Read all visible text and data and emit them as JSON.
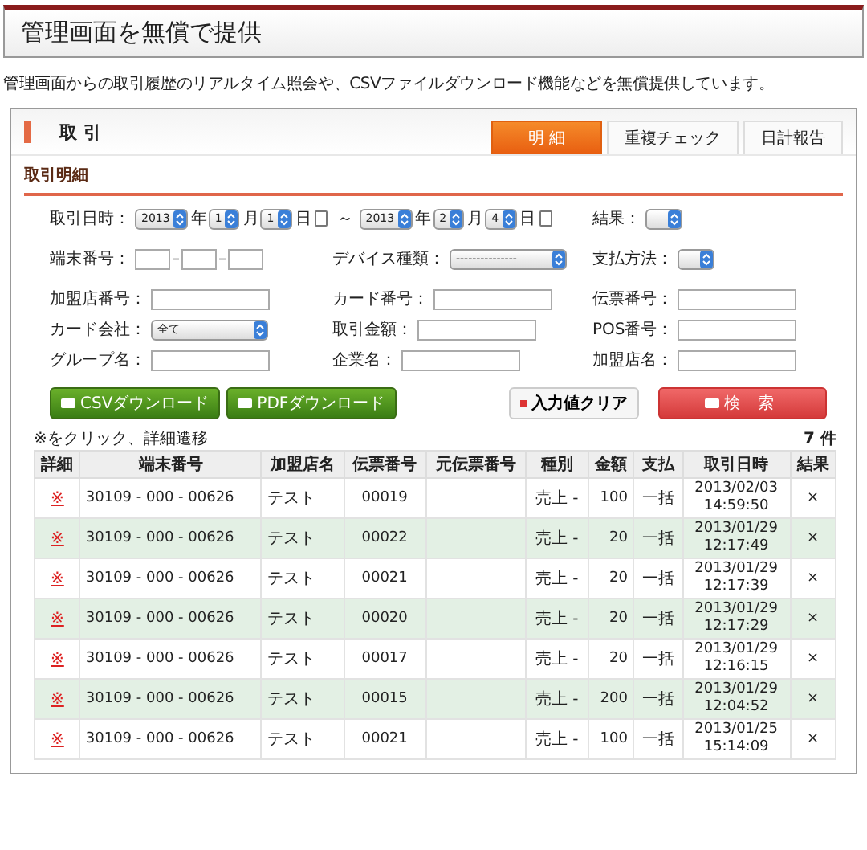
{
  "heading": "管理画面を無償で提供",
  "lead": "管理画面からの取引履歴のリアルタイム照会や、CSVファイルダウンロード機能などを無償提供しています。",
  "panel": {
    "title": "取 引",
    "tabs": [
      {
        "label": "明 細",
        "selected": true
      },
      {
        "label": "重複チェック",
        "selected": false
      },
      {
        "label": "日計報告",
        "selected": false
      }
    ],
    "section": "取引明細",
    "fields": [
      {
        "kind": "date",
        "label": "取引日時：",
        "from": [
          {
            "value": "2013",
            "unit": "年"
          },
          {
            "value": "1",
            "unit": "月"
          },
          {
            "value": "1",
            "unit": "日"
          }
        ],
        "separator": "～",
        "to": [
          {
            "value": "2013",
            "unit": "年"
          },
          {
            "value": "2",
            "unit": "月"
          },
          {
            "value": "4",
            "unit": "日"
          }
        ]
      },
      {
        "kind": "select",
        "label": "結果："
      },
      {
        "kind": "terminal",
        "label": "端末番号：",
        "dashes": [
          "–",
          "–"
        ]
      },
      {
        "kind": "select",
        "label": "デバイス種類：",
        "value": "---------------"
      },
      {
        "kind": "select",
        "label": "支払方法："
      },
      {
        "kind": "text",
        "label": "加盟店番号："
      },
      {
        "kind": "text",
        "label": "カード番号："
      },
      {
        "kind": "text",
        "label": "伝票番号："
      },
      {
        "kind": "select",
        "label": "カード会社：",
        "value": "全て"
      },
      {
        "kind": "text",
        "label": "取引金額："
      },
      {
        "kind": "text",
        "label": "POS番号："
      },
      {
        "kind": "text",
        "label": "グループ名："
      },
      {
        "kind": "text",
        "label": "企業名："
      },
      {
        "kind": "text",
        "label": "加盟店名："
      }
    ],
    "buttons": [
      {
        "kind": "download",
        "label": "CSVダウンロード"
      },
      {
        "kind": "download",
        "label": "PDFダウンロード"
      },
      {
        "kind": "clear",
        "label": "入力値クリア"
      },
      {
        "kind": "search",
        "label": "検 索"
      }
    ],
    "note": "※をクリック、詳細遷移",
    "count": "7 件",
    "table": {
      "columns": [
        "詳細",
        "端末番号",
        "加盟店名",
        "伝票番号",
        "元伝票番号",
        "種別",
        "金額",
        "支払",
        "取引日時",
        "結果"
      ],
      "rows": [
        {
          "detail": "※",
          "terminal": "30109 - 000 - 00626",
          "store": "テスト",
          "slip": "00019",
          "type": "売上 -",
          "amount": "100",
          "payment": "一括",
          "date": "2013/02/03",
          "time": "14:59:50",
          "result": "×"
        },
        {
          "detail": "※",
          "terminal": "30109 - 000 - 00626",
          "store": "テスト",
          "slip": "00022",
          "type": "売上 -",
          "amount": "20",
          "payment": "一括",
          "date": "2013/01/29",
          "time": "12:17:49",
          "result": "×"
        },
        {
          "detail": "※",
          "terminal": "30109 - 000 - 00626",
          "store": "テスト",
          "slip": "00021",
          "type": "売上 -",
          "amount": "20",
          "payment": "一括",
          "date": "2013/01/29",
          "time": "12:17:39",
          "result": "×"
        },
        {
          "detail": "※",
          "terminal": "30109 - 000 - 00626",
          "store": "テスト",
          "slip": "00020",
          "type": "売上 -",
          "amount": "20",
          "payment": "一括",
          "date": "2013/01/29",
          "time": "12:17:29",
          "result": "×"
        },
        {
          "detail": "※",
          "terminal": "30109 - 000 - 00626",
          "store": "テスト",
          "slip": "00017",
          "type": "売上 -",
          "amount": "20",
          "payment": "一括",
          "date": "2013/01/29",
          "time": "12:16:15",
          "result": "×"
        },
        {
          "detail": "※",
          "terminal": "30109 - 000 - 00626",
          "store": "テスト",
          "slip": "00015",
          "type": "売上 -",
          "amount": "200",
          "payment": "一括",
          "date": "2013/01/29",
          "time": "12:04:52",
          "result": "×"
        },
        {
          "detail": "※",
          "terminal": "30109 - 000 - 00626",
          "store": "テスト",
          "slip": "00021",
          "type": "売上 -",
          "amount": "100",
          "payment": "一括",
          "date": "2013/01/25",
          "time": "15:14:09",
          "result": "×"
        }
      ]
    }
  }
}
